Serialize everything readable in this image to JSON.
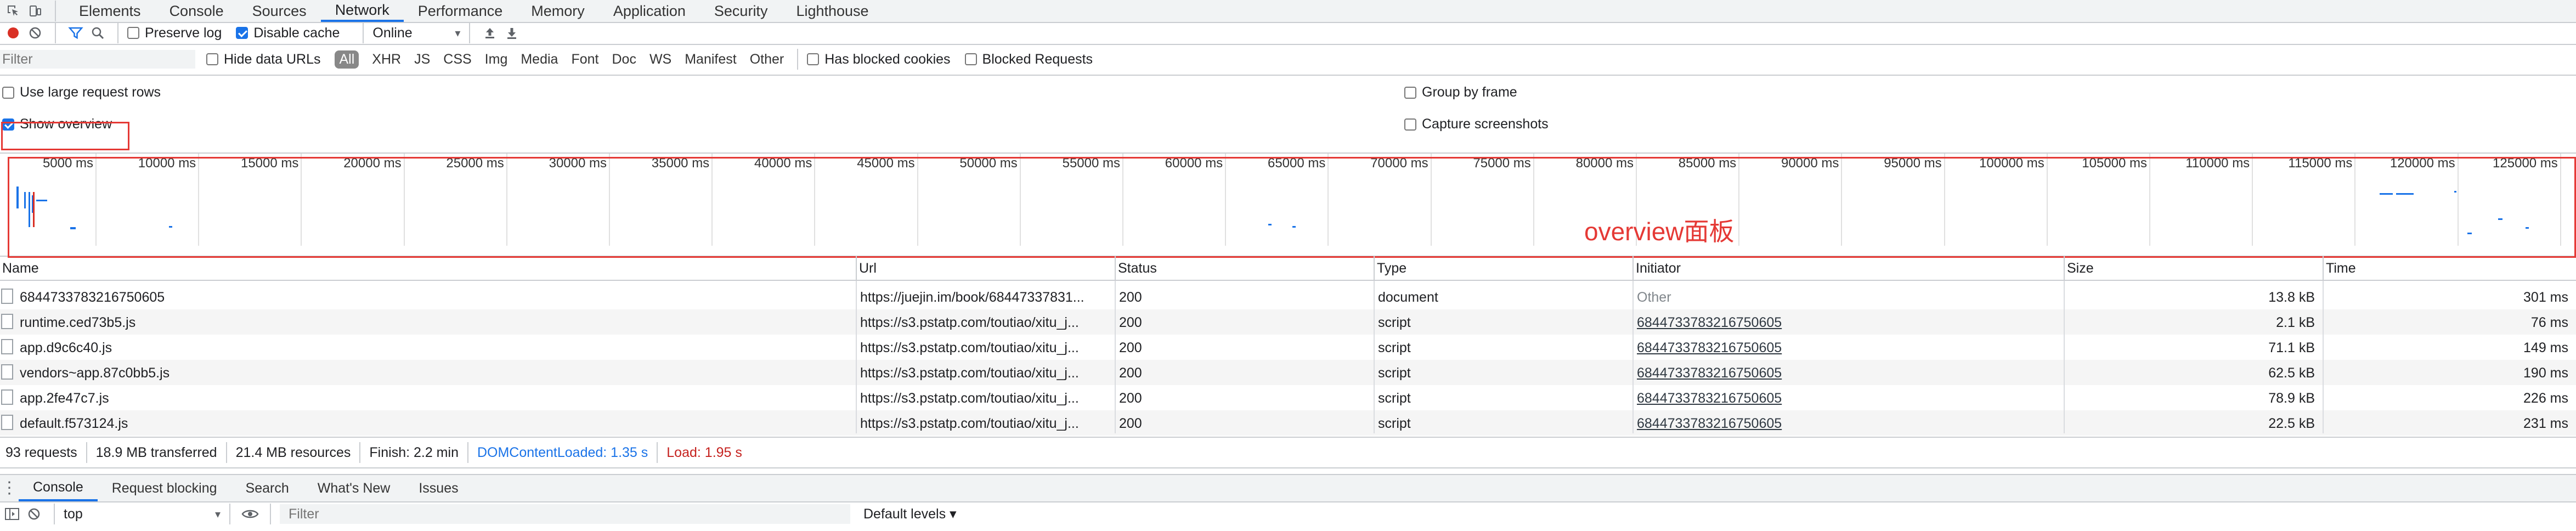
{
  "tabs": [
    "Elements",
    "Console",
    "Sources",
    "Network",
    "Performance",
    "Memory",
    "Application",
    "Security",
    "Lighthouse"
  ],
  "active_tab": "Network",
  "toolbar": {
    "preserve_log": "Preserve log",
    "disable_cache": "Disable cache",
    "throttle": "Online",
    "throttle_arrow": "▾"
  },
  "filter_bar": {
    "placeholder": "Filter",
    "hide_data_urls": "Hide data URLs",
    "types": [
      "All",
      "XHR",
      "JS",
      "CSS",
      "Img",
      "Media",
      "Font",
      "Doc",
      "WS",
      "Manifest",
      "Other"
    ],
    "has_blocked_cookies": "Has blocked cookies",
    "blocked_requests": "Blocked Requests"
  },
  "settings": {
    "large_rows": "Use large request rows",
    "show_overview": "Show overview",
    "group_by_frame": "Group by frame",
    "capture_screenshots": "Capture screenshots"
  },
  "timeline_ticks": [
    "5000 ms",
    "10000 ms",
    "15000 ms",
    "20000 ms",
    "25000 ms",
    "30000 ms",
    "35000 ms",
    "40000 ms",
    "45000 ms",
    "50000 ms",
    "55000 ms",
    "60000 ms",
    "65000 ms",
    "70000 ms",
    "75000 ms",
    "80000 ms",
    "85000 ms",
    "90000 ms",
    "95000 ms",
    "100000 ms",
    "105000 ms",
    "110000 ms",
    "115000 ms",
    "120000 ms",
    "125000 ms"
  ],
  "overview_annotation": "overview面板",
  "columns": [
    "Name",
    "Url",
    "Status",
    "Type",
    "Initiator",
    "Size",
    "Time"
  ],
  "rows": [
    {
      "name": "6844733783216750605",
      "url": "https://juejin.im/book/68447337831...",
      "status": "200",
      "type": "document",
      "initiator": "Other",
      "size": "13.8 kB",
      "time": "301 ms"
    },
    {
      "name": "runtime.ced73b5.js",
      "url": "https://s3.pstatp.com/toutiao/xitu_j...",
      "status": "200",
      "type": "script",
      "initiator": "6844733783216750605",
      "size": "2.1 kB",
      "time": "76 ms"
    },
    {
      "name": "app.d9c6c40.js",
      "url": "https://s3.pstatp.com/toutiao/xitu_j...",
      "status": "200",
      "type": "script",
      "initiator": "6844733783216750605",
      "size": "71.1 kB",
      "time": "149 ms"
    },
    {
      "name": "vendors~app.87c0bb5.js",
      "url": "https://s3.pstatp.com/toutiao/xitu_j...",
      "status": "200",
      "type": "script",
      "initiator": "6844733783216750605",
      "size": "62.5 kB",
      "time": "190 ms"
    },
    {
      "name": "app.2fe47c7.js",
      "url": "https://s3.pstatp.com/toutiao/xitu_j...",
      "status": "200",
      "type": "script",
      "initiator": "6844733783216750605",
      "size": "78.9 kB",
      "time": "226 ms"
    },
    {
      "name": "default.f573124.js",
      "url": "https://s3.pstatp.com/toutiao/xitu_j...",
      "status": "200",
      "type": "script",
      "initiator": "6844733783216750605",
      "size": "22.5 kB",
      "time": "231 ms"
    }
  ],
  "summary": {
    "requests": "93 requests",
    "transferred": "18.9 MB transferred",
    "resources": "21.4 MB resources",
    "finish": "Finish: 2.2 min",
    "dcl": "DOMContentLoaded: 1.35 s",
    "load": "Load: 1.95 s"
  },
  "drawer_tabs": [
    "Console",
    "Request blocking",
    "Search",
    "What's New",
    "Issues"
  ],
  "console_bar": {
    "context": "top",
    "filter_placeholder": "Filter",
    "levels": "Default levels ▾"
  },
  "colors": {
    "accent": "#1a73e8",
    "annotation_red": "#e53935",
    "dcl_blue": "#1a73e8",
    "load_red": "#c5221f"
  }
}
